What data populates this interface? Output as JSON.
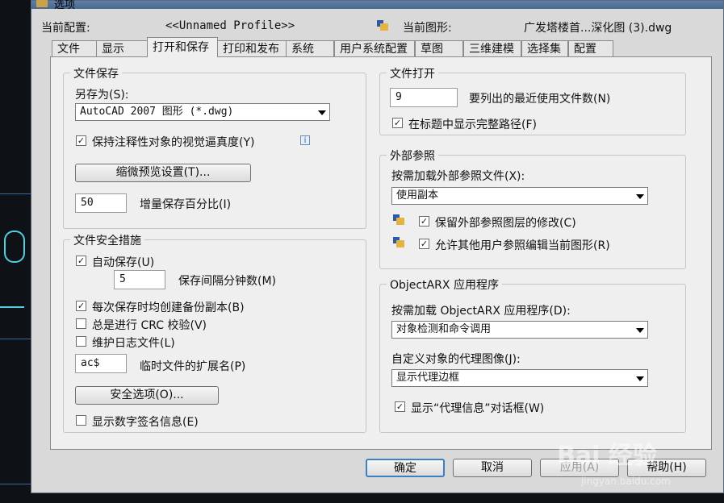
{
  "window": {
    "title": "选项"
  },
  "header": {
    "profile_label": "当前配置:",
    "profile_value": "<<Unnamed Profile>>",
    "drawing_label": "当前图形:",
    "drawing_value": "广发塔楼首...深化图 (3).dwg"
  },
  "tabs": [
    {
      "label": "文件"
    },
    {
      "label": "显示"
    },
    {
      "label": "打开和保存"
    },
    {
      "label": "打印和发布"
    },
    {
      "label": "系统"
    },
    {
      "label": "用户系统配置"
    },
    {
      "label": "草图"
    },
    {
      "label": "三维建模"
    },
    {
      "label": "选择集"
    },
    {
      "label": "配置"
    }
  ],
  "file_save": {
    "title": "文件保存",
    "save_as_label": "另存为(S):",
    "save_as_value": "AutoCAD 2007 图形 (*.dwg)",
    "annotative_label": "保持注释性对象的视觉逼真度(Y)",
    "thumbnail_button": "缩微预览设置(T)...",
    "incremental_value": "50",
    "incremental_label": "增量保存百分比(I)"
  },
  "file_safety": {
    "title": "文件安全措施",
    "autosave_label": "自动保存(U)",
    "minutes_value": "5",
    "minutes_label": "保存间隔分钟数(M)",
    "backup_label": "每次保存时均创建备份副本(B)",
    "crc_label": "总是进行 CRC 校验(V)",
    "log_label": "维护日志文件(L)",
    "ext_value": "ac$",
    "ext_label": "临时文件的扩展名(P)",
    "security_button": "安全选项(O)...",
    "signature_label": "显示数字签名信息(E)"
  },
  "file_open": {
    "title": "文件打开",
    "recent_value": "9",
    "recent_label": "要列出的最近使用文件数(N)",
    "fullpath_label": "在标题中显示完整路径(F)"
  },
  "xref": {
    "title": "外部参照",
    "demand_label": "按需加载外部参照文件(X):",
    "demand_value": "使用副本",
    "retain_label": "保留外部参照图层的修改(C)",
    "allow_label": "允许其他用户参照编辑当前图形(R)"
  },
  "arx": {
    "title": "ObjectARX 应用程序",
    "demand_label": "按需加载 ObjectARX 应用程序(D):",
    "demand_value": "对象检测和命令调用",
    "proxy_label": "自定义对象的代理图像(J):",
    "proxy_value": "显示代理边框",
    "proxy_info_label": "显示“代理信息”对话框(W)"
  },
  "footer": {
    "ok": "确定",
    "cancel": "取消",
    "apply": "应用(A)",
    "help": "帮助(H)"
  },
  "watermark": {
    "brand": "Bai 经验",
    "url": "jingyan.baidu.com"
  }
}
